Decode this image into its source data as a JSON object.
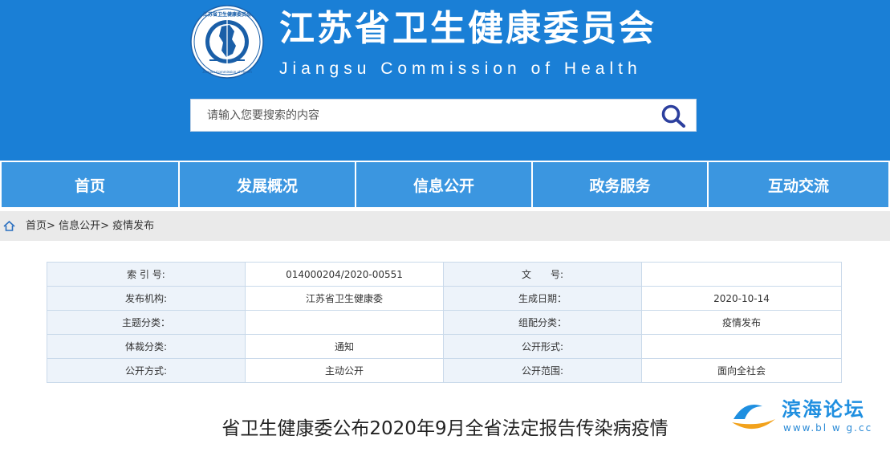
{
  "header": {
    "title": "江苏省卫生健康委员会",
    "subtitle": "Jiangsu Commission of Health",
    "logo_text": "江苏省卫生健康委员会 Jiangsu Commission of Health",
    "bg_color": "#1a7fd6"
  },
  "search": {
    "placeholder": "请输入您要搜索的内容",
    "icon": "search-icon"
  },
  "nav": {
    "items": [
      {
        "label": "首页"
      },
      {
        "label": "发展概况"
      },
      {
        "label": "信息公开"
      },
      {
        "label": "政务服务"
      },
      {
        "label": "互动交流"
      }
    ],
    "item_color": "#3b96e0"
  },
  "breadcrumb": {
    "icon": "home-icon",
    "home": "首页",
    "sep": ">",
    "section": "信息公开",
    "current": "疫情发布"
  },
  "meta_table": {
    "rows": [
      [
        "索 引 号:",
        "014000204/2020-00551",
        "文　　号:",
        ""
      ],
      [
        "发布机构:",
        "江苏省卫生健康委",
        "生成日期：",
        "2020-10-14"
      ],
      [
        "主题分类：",
        "",
        "组配分类：",
        "疫情发布"
      ],
      [
        "体裁分类:",
        "通知",
        "公开形式:",
        ""
      ],
      [
        "公开方式:",
        "主动公开",
        "公开范围:",
        "面向全社会"
      ]
    ]
  },
  "article": {
    "title": "省卫生健康委公布2020年9月全省法定报告传染病疫情"
  },
  "watermark": {
    "text": "滨海论坛",
    "url": "www.bl  w  g.cc"
  }
}
